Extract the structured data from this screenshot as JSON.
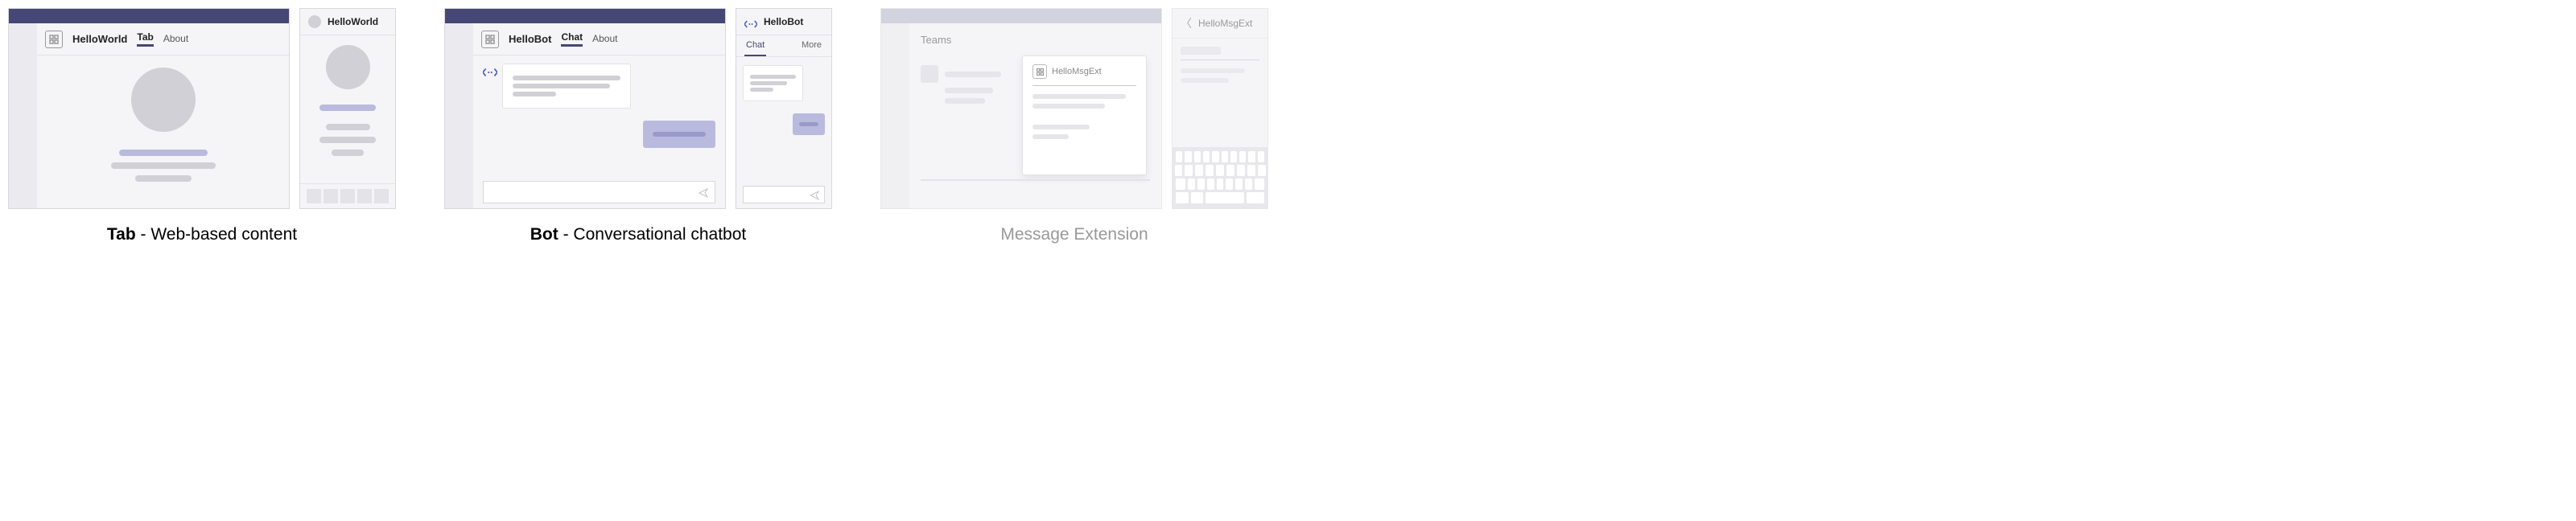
{
  "tab": {
    "desktop": {
      "app_name": "HelloWorld",
      "tabs": {
        "tab": "Tab",
        "about": "About"
      }
    },
    "mobile": {
      "title": "HelloWorld"
    },
    "caption_bold": "Tab",
    "caption_rest": " - Web-based content"
  },
  "bot": {
    "desktop": {
      "app_name": "HelloBot",
      "tabs": {
        "chat": "Chat",
        "about": "About"
      }
    },
    "mobile": {
      "title": "HelloBot",
      "tabs": {
        "chat": "Chat",
        "more": "More"
      }
    },
    "caption_bold": "Bot",
    "caption_rest": " - Conversational chatbot"
  },
  "msgext": {
    "desktop": {
      "sidebar_label": "Teams",
      "card_title": "HelloMsgExt"
    },
    "mobile": {
      "title": "HelloMsgExt"
    },
    "caption": "Message Extension"
  }
}
